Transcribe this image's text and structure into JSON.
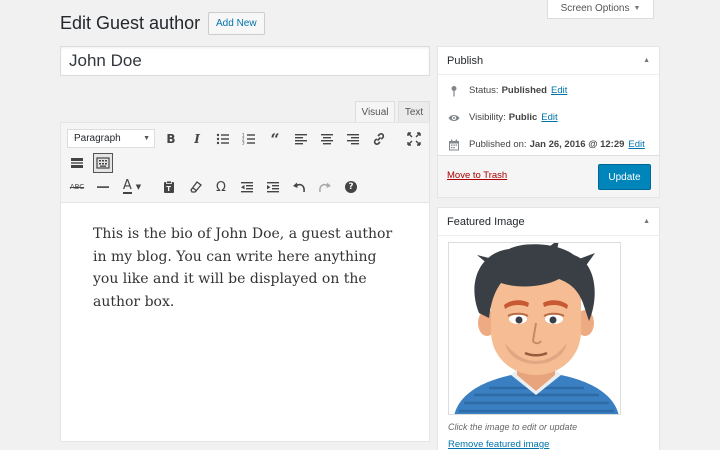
{
  "header": {
    "screen_options": "Screen Options",
    "title": "Edit Guest author",
    "add_new": "Add New"
  },
  "post": {
    "title_value": "John Doe",
    "body": "This is the bio of John Doe, a guest author in my blog. You can write here anything you like and it will be displayed on the author box."
  },
  "editor": {
    "tabs": {
      "visual": "Visual",
      "text": "Text"
    },
    "format_select": "Paragraph",
    "toolbar_row1": [
      "bold-icon",
      "italic-icon",
      "bullet-list-icon",
      "numbered-list-icon",
      "blockquote-icon",
      "align-left-icon",
      "align-center-icon",
      "align-right-icon",
      "link-icon",
      "fullscreen-icon",
      "read-more-icon",
      "toolbar-toggle-icon"
    ],
    "toolbar_row2": [
      "strikethrough-icon",
      "horizontal-rule-icon",
      "text-color-icon",
      "paste-as-text-icon",
      "clear-formatting-icon",
      "special-character-icon",
      "outdent-icon",
      "indent-icon",
      "undo-icon",
      "redo-icon",
      "help-icon"
    ],
    "strikethrough_label": "ABC",
    "text_color_label": "A",
    "special_char_label": "Ω",
    "help_label": "?"
  },
  "publish": {
    "heading": "Publish",
    "status_label": "Status:",
    "status_value": "Published",
    "visibility_label": "Visibility:",
    "visibility_value": "Public",
    "published_label": "Published on:",
    "published_value": "Jan 26, 2016 @ 12:29",
    "edit_link": "Edit",
    "trash": "Move to Trash",
    "update": "Update"
  },
  "featured_image": {
    "heading": "Featured Image",
    "note": "Click the image to edit or update",
    "remove": "Remove featured image"
  },
  "colors": {
    "link": "#0073aa",
    "primary_button": "#0085ba",
    "trash": "#aa0000",
    "page_bg": "#f1f1f1"
  }
}
